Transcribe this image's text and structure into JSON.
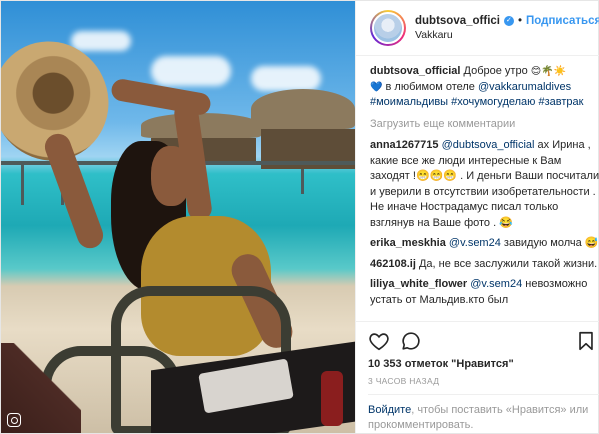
{
  "post": {
    "username": "dubtsova_offici",
    "follow_label": "Подписаться",
    "location": "Vakkaru",
    "caption": {
      "user": "dubtsova_official",
      "text1": "Доброе утро",
      "emoji1": "😊🌴☀️",
      "heart": "💙",
      "text2": "в любимом отеле",
      "mention": "@vakkarumaldives",
      "hashtags": "#моимальдивы #хочумогуделаю #завтрак"
    },
    "load_more": "Загрузить еще комментарии",
    "comments": [
      {
        "user": "anna1267715",
        "mention": "@dubtsova_official",
        "text": "ах Ирина , какие все же люди интересные к Вам заходят !😁😁😁 . И деньги Ваши посчитали и уверили в отсутствии изобретательности . Не иначе Нострадамус писал только взглянув на Ваше фото . 😂"
      },
      {
        "user": "erika_meskhia",
        "mention": "@v.sem24",
        "text": "завидую молча 😅"
      },
      {
        "user": "462108.ij",
        "mention": "",
        "text": "Да, не все заслужили такой жизни."
      },
      {
        "user": "liliya_white_flower",
        "mention": "@v.sem24",
        "text": "невозможно устать от Мальдив.кто был"
      }
    ],
    "likes": "10 353 отметок \"Нравится\"",
    "time": "3 часов назад",
    "login_link": "Войдите",
    "login_text": ", чтобы поставить «Нравится» или прокомментировать."
  },
  "icons": [
    "heart-icon",
    "comment-icon",
    "bookmark-icon",
    "verified-icon",
    "instagram-icon"
  ],
  "colors": {
    "link": "#003569",
    "follow": "#3897f0",
    "muted": "#999999"
  }
}
